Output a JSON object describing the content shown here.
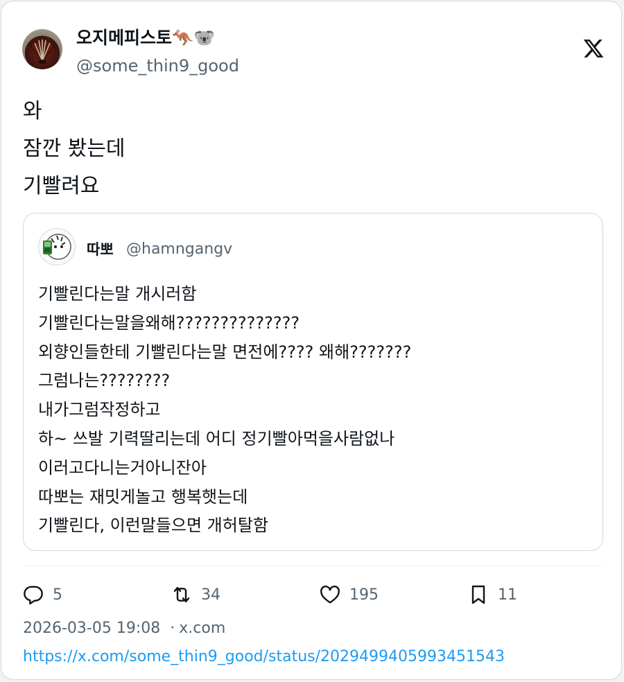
{
  "author": {
    "display_name": "오지메피스토🦘🐨",
    "handle": "@some_thin9_good"
  },
  "tweet_lines": [
    "와",
    "잠깐 봤는데",
    "기빨려요"
  ],
  "quote": {
    "display_name": "따뽀",
    "handle": "@hamngangv",
    "lines": [
      "기빨린다는말 개시러함",
      "기빨린다는말을왜해??????????????",
      "외향인들한테 기빨린다는말 면전에???? 왜해???????",
      "그럼나는????????",
      "내가그럼작정하고",
      "하~ 쓰발 기력딸리는데 어디 정기빨아먹을사람없나",
      "이러고다니는거아니잔아",
      "따뽀는 재밋게놀고 행복햇는데",
      "기빨린다, 이런말들으면 개허탈함"
    ]
  },
  "actions": {
    "replies": "5",
    "retweets": "34",
    "likes": "195",
    "bookmarks": "11"
  },
  "meta": {
    "timestamp": "2026-03-05 19:08",
    "separator": "·",
    "source": "x.com",
    "url": "https://x.com/some_thin9_good/status/2029499405993451543"
  },
  "icons": {
    "platform": "x-logo-icon",
    "reply": "reply-icon",
    "retweet": "retweet-icon",
    "like": "heart-icon",
    "bookmark": "bookmark-icon"
  },
  "colors": {
    "text": "#0f1419",
    "secondary": "#536471",
    "link": "#1d9bf0",
    "border": "#cfd9de"
  }
}
